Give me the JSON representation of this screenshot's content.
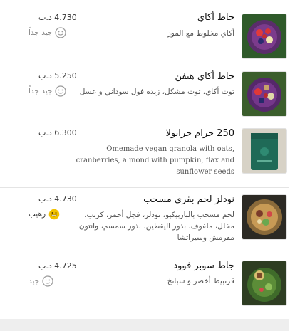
{
  "menu_items": [
    {
      "name": "جاط أكاي",
      "description": "أكاي مخلوط مع الموز",
      "price": "4.730 د.ب",
      "rating_label": "جيد جداً",
      "rating_icon": "neutral-face-icon",
      "image_icon": "acai-bowl-image"
    },
    {
      "name": "جاط أكاي هيفن",
      "description": "توت أكاي، توت مشكل، زبدة فول سوداني و عسل",
      "price": "5.250 د.ب",
      "rating_label": "جيد جداً",
      "rating_icon": "neutral-face-icon",
      "image_icon": "acai-bowl-image"
    },
    {
      "name": "250 جرام جرانولا",
      "description": "Omemade vegan granola with oats, cranberries, almond with pumpkin, flax and sunflower seeds",
      "price": "6.300 د.ب",
      "image_icon": "granola-bag-image"
    },
    {
      "name": "نودلز لحم بقري مسحب",
      "description": "لحم مسحب بالباربيكيو، نودلز، فجل أحمر، كرنب، مخلل، ملفوف، بذور اليقطين، بذور سمسم، وانتون مقرمش وسيراتشا",
      "price": "4.730 د.ب",
      "rating_label": "رهيب",
      "rating_icon": "grin-face-icon",
      "image_icon": "noodle-bowl-image"
    },
    {
      "name": "جاط سوبر فوود",
      "description": "قرنبيط أخضر و سبانخ",
      "price": "4.725 د.ب",
      "rating_label": "جيد",
      "rating_icon": "neutral-face-icon",
      "image_icon": "superfood-bowl-image"
    }
  ],
  "colors": {
    "excellent_face": "#f2c200",
    "neutral_face": "#9a9a9a",
    "divider": "#e4e4e4"
  }
}
